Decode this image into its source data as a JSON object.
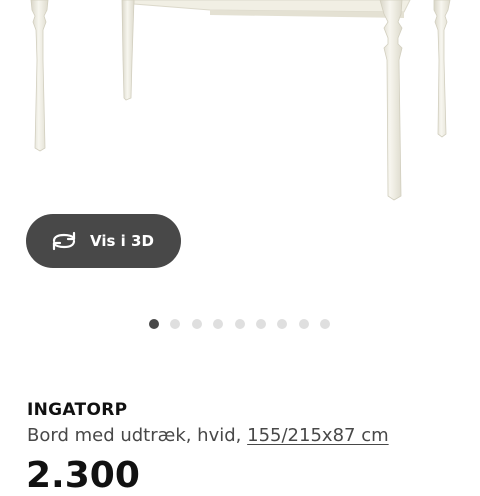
{
  "view3d": {
    "label": "Vis i 3D",
    "icon": "rotate-3d-icon"
  },
  "carousel": {
    "total": 9,
    "active": 0
  },
  "product": {
    "name": "INGATORP",
    "description": "Bord med udtræk, hvid,",
    "dimensions": "155/215x87 cm",
    "price": "2.300"
  },
  "colors": {
    "button_bg": "#484848",
    "dot_active": "#484848",
    "dot_inactive": "#dfdfdf",
    "table_white": "#f2f0e6"
  }
}
